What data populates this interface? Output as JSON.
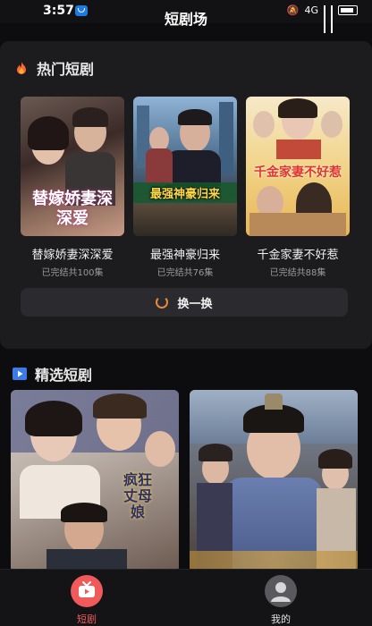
{
  "status": {
    "time": "3:57",
    "net": "4G"
  },
  "header": {
    "title": "短剧场"
  },
  "hot": {
    "title": "热门短剧",
    "items": [
      {
        "name": "替嫁娇妻深深爱",
        "meta": "已完结共100集",
        "poster_text": "替嫁娇妻深深爱"
      },
      {
        "name": "最强神豪归来",
        "meta": "已完结共76集",
        "poster_text": "最强神豪归来"
      },
      {
        "name": "千金家妻不好惹",
        "meta": "已完结共88集",
        "poster_text": "千金家妻不好惹"
      }
    ],
    "refresh_label": "换一换"
  },
  "picks": {
    "title": "精选短剧",
    "items": [
      {
        "poster_text": "疯狂丈母娘"
      },
      {
        "poster_text": ""
      }
    ]
  },
  "nav": {
    "items": [
      {
        "label": "短剧",
        "active": true
      },
      {
        "label": "我的",
        "active": false
      }
    ]
  },
  "colors": {
    "accent": "#e8893a",
    "active_nav": "#f05a5a",
    "fire": "#ff6a2b",
    "play": "#3b7be8"
  }
}
